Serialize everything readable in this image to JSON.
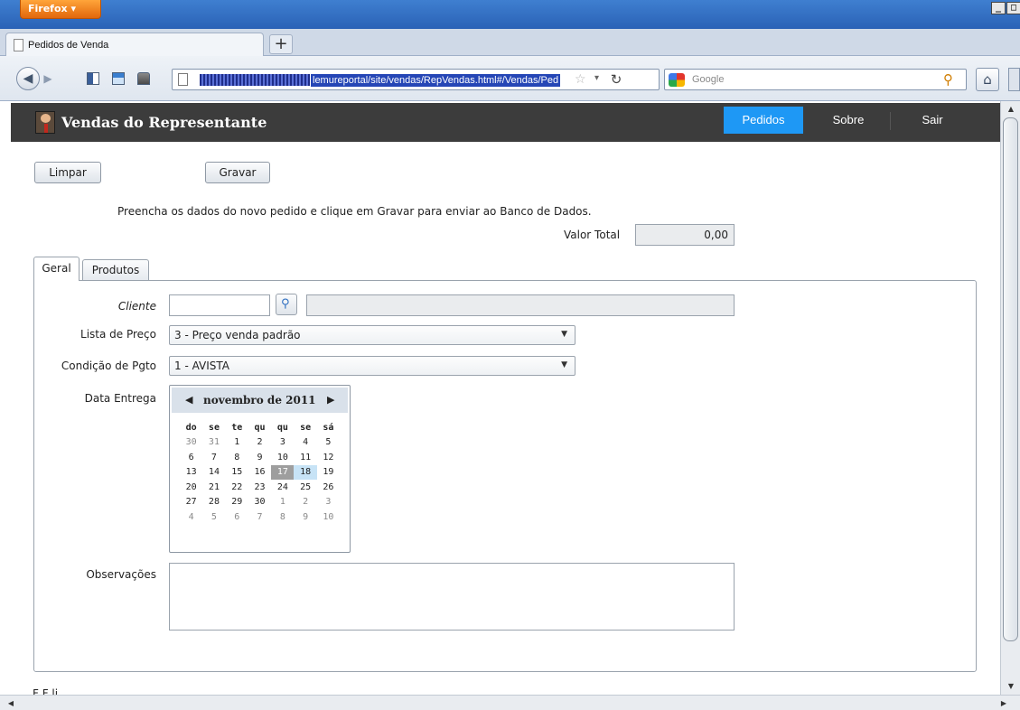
{
  "browser": {
    "menu_label": "Firefox ▾",
    "tab_title": "Pedidos de Venda",
    "new_tab_label": "+",
    "url": "lemureportal/site/vendas/RepVendas.html#/Vendas/Ped",
    "search_placeholder": "Google",
    "window_controls": [
      "_",
      "□"
    ]
  },
  "app": {
    "title": "Vendas do Representante",
    "nav": [
      {
        "label": "Pedidos",
        "active": true
      },
      {
        "label": "Sobre"
      },
      {
        "label": "Sair"
      }
    ]
  },
  "actions": {
    "clear_label": "Limpar",
    "save_label": "Gravar"
  },
  "hint": "Preencha os dados do novo pedido e clique em Gravar para enviar ao Banco de Dados.",
  "total": {
    "label": "Valor Total",
    "value": "0,00"
  },
  "tabs": [
    {
      "label": "Geral",
      "active": true
    },
    {
      "label": "Produtos"
    }
  ],
  "form": {
    "cliente_label": "Cliente",
    "cliente_code": "",
    "cliente_name": "",
    "lista_preco_label": "Lista de Preço",
    "lista_preco_value": "3 - Preço venda padrão",
    "condicao_label": "Condição de Pgto",
    "condicao_value": "1 - AVISTA",
    "data_entrega_label": "Data Entrega",
    "observacoes_label": "Observações",
    "observacoes_value": ""
  },
  "calendar": {
    "title": "novembro de 2011",
    "weekdays": [
      "do",
      "se",
      "te",
      "qu",
      "qu",
      "se",
      "sá"
    ],
    "weeks": [
      [
        "30",
        "31",
        "1",
        "2",
        "3",
        "4",
        "5"
      ],
      [
        "6",
        "7",
        "8",
        "9",
        "10",
        "11",
        "12"
      ],
      [
        "13",
        "14",
        "15",
        "16",
        "17",
        "18",
        "19"
      ],
      [
        "20",
        "21",
        "22",
        "23",
        "24",
        "25",
        "26"
      ],
      [
        "27",
        "28",
        "29",
        "30",
        "1",
        "2",
        "3"
      ],
      [
        "4",
        "5",
        "6",
        "7",
        "8",
        "9",
        "10"
      ]
    ],
    "today": "17",
    "selected": "18"
  },
  "footer_text": "F                    F      li"
}
